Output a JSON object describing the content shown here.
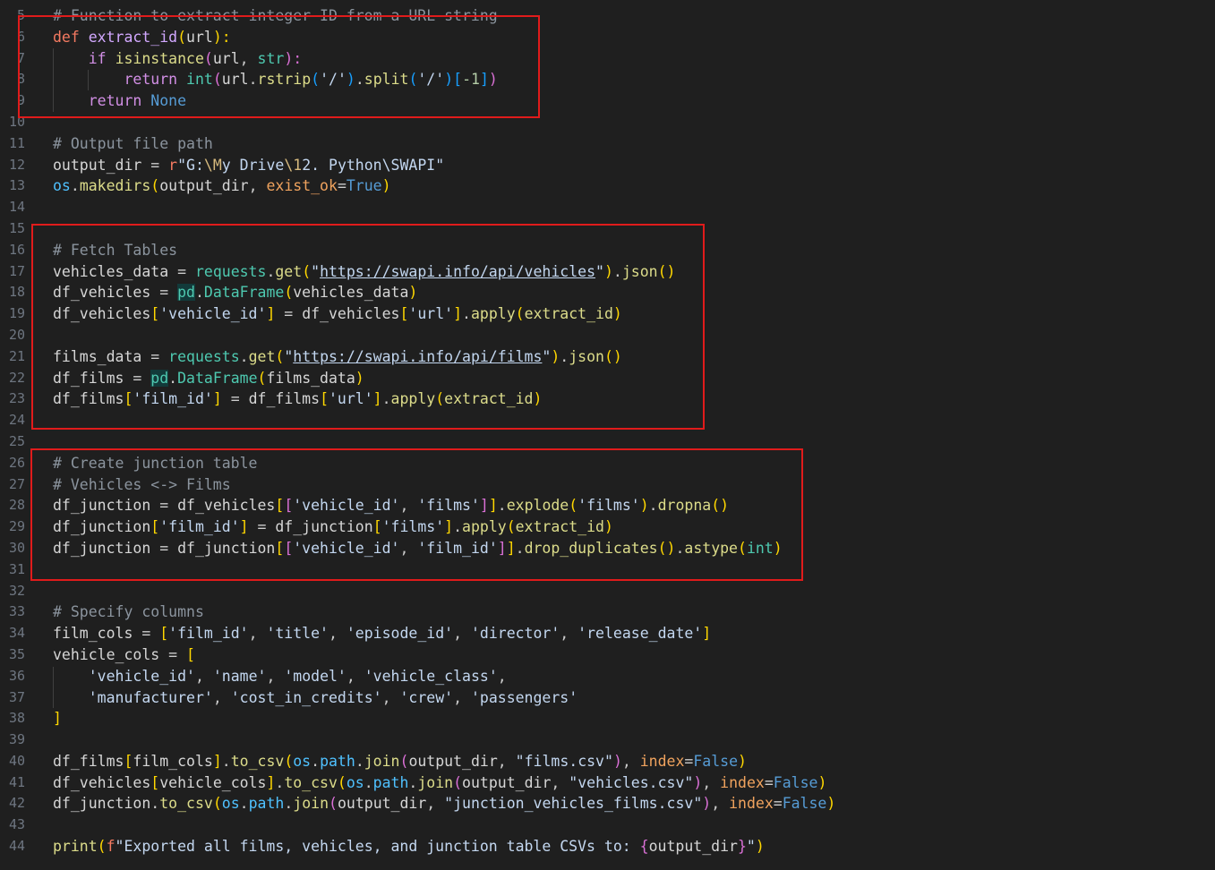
{
  "gutter": {
    "line_numbers": [
      "5",
      "6",
      "7",
      "8",
      "9",
      "10",
      "11",
      "12",
      "13",
      "14",
      "15",
      "16",
      "17",
      "18",
      "19",
      "20",
      "21",
      "22",
      "23",
      "24",
      "25",
      "26",
      "27",
      "28",
      "29",
      "30",
      "31",
      "32",
      "33",
      "34",
      "35",
      "36",
      "37",
      "38",
      "39",
      "40",
      "41",
      "42",
      "43",
      "44"
    ]
  },
  "code_lines": [
    [
      {
        "t": "# Function to extract integer ID from a URL string",
        "c": "cm"
      }
    ],
    [
      {
        "t": "def ",
        "c": "kw"
      },
      {
        "t": "extract_id",
        "c": "fn"
      },
      {
        "t": "(",
        "c": "p1"
      },
      {
        "t": "url",
        "c": "var"
      },
      {
        "t": "):",
        "c": "p1"
      }
    ],
    [
      {
        "t": "    ",
        "c": "op"
      },
      {
        "t": "if ",
        "c": "ctl"
      },
      {
        "t": "isinstance",
        "c": "fnB"
      },
      {
        "t": "(",
        "c": "p2"
      },
      {
        "t": "url",
        "c": "var"
      },
      {
        "t": ", ",
        "c": "op"
      },
      {
        "t": "str",
        "c": "builtin"
      },
      {
        "t": "):",
        "c": "p2"
      }
    ],
    [
      {
        "t": "        ",
        "c": "op"
      },
      {
        "t": "return ",
        "c": "ctl"
      },
      {
        "t": "int",
        "c": "builtin"
      },
      {
        "t": "(",
        "c": "p2"
      },
      {
        "t": "url",
        "c": "var"
      },
      {
        "t": ".",
        "c": "op"
      },
      {
        "t": "rstrip",
        "c": "fnB"
      },
      {
        "t": "(",
        "c": "p3"
      },
      {
        "t": "'/'",
        "c": "str"
      },
      {
        "t": ")",
        "c": "p3"
      },
      {
        "t": ".",
        "c": "op"
      },
      {
        "t": "split",
        "c": "fnB"
      },
      {
        "t": "(",
        "c": "p3"
      },
      {
        "t": "'/'",
        "c": "str"
      },
      {
        "t": ")",
        "c": "p3"
      },
      {
        "t": "[",
        "c": "p3"
      },
      {
        "t": "-1",
        "c": "num"
      },
      {
        "t": "]",
        "c": "p3"
      },
      {
        "t": ")",
        "c": "p2"
      }
    ],
    [
      {
        "t": "    ",
        "c": "op"
      },
      {
        "t": "return ",
        "c": "ctl"
      },
      {
        "t": "None",
        "c": "const"
      }
    ],
    [],
    [
      {
        "t": "# Output file path",
        "c": "cm"
      }
    ],
    [
      {
        "t": "output_dir",
        "c": "var"
      },
      {
        "t": " = ",
        "c": "op"
      },
      {
        "t": "r",
        "c": "kw"
      },
      {
        "t": "\"G:",
        "c": "str"
      },
      {
        "t": "\\M",
        "c": "esc"
      },
      {
        "t": "y Drive",
        "c": "str"
      },
      {
        "t": "\\1",
        "c": "esc"
      },
      {
        "t": "2. Python\\SWAPI\"",
        "c": "str"
      }
    ],
    [
      {
        "t": "os",
        "c": "mod"
      },
      {
        "t": ".",
        "c": "op"
      },
      {
        "t": "makedirs",
        "c": "fnB"
      },
      {
        "t": "(",
        "c": "p1"
      },
      {
        "t": "output_dir",
        "c": "var"
      },
      {
        "t": ", ",
        "c": "op"
      },
      {
        "t": "exist_ok",
        "c": "param"
      },
      {
        "t": "=",
        "c": "op"
      },
      {
        "t": "True",
        "c": "const"
      },
      {
        "t": ")",
        "c": "p1"
      }
    ],
    [],
    [],
    [
      {
        "t": "# Fetch Tables",
        "c": "cm"
      }
    ],
    [
      {
        "t": "vehicles_data",
        "c": "var"
      },
      {
        "t": " = ",
        "c": "op"
      },
      {
        "t": "requests",
        "c": "builtin"
      },
      {
        "t": ".",
        "c": "op"
      },
      {
        "t": "get",
        "c": "fnB"
      },
      {
        "t": "(",
        "c": "p1"
      },
      {
        "t": "\"",
        "c": "str"
      },
      {
        "t": "https://swapi.info/api/vehicles",
        "c": "url"
      },
      {
        "t": "\"",
        "c": "str"
      },
      {
        "t": ")",
        "c": "p1"
      },
      {
        "t": ".",
        "c": "op"
      },
      {
        "t": "json",
        "c": "fnB"
      },
      {
        "t": "()",
        "c": "p1"
      }
    ],
    [
      {
        "t": "df_vehicles",
        "c": "var"
      },
      {
        "t": " = ",
        "c": "op"
      },
      {
        "t": "pd",
        "c": "builtin hl"
      },
      {
        "t": ".",
        "c": "op"
      },
      {
        "t": "DataFrame",
        "c": "builtin"
      },
      {
        "t": "(",
        "c": "p1"
      },
      {
        "t": "vehicles_data",
        "c": "var"
      },
      {
        "t": ")",
        "c": "p1"
      }
    ],
    [
      {
        "t": "df_vehicles",
        "c": "var"
      },
      {
        "t": "[",
        "c": "p1"
      },
      {
        "t": "'vehicle_id'",
        "c": "str"
      },
      {
        "t": "]",
        "c": "p1"
      },
      {
        "t": " = ",
        "c": "op"
      },
      {
        "t": "df_vehicles",
        "c": "var"
      },
      {
        "t": "[",
        "c": "p1"
      },
      {
        "t": "'url'",
        "c": "str"
      },
      {
        "t": "]",
        "c": "p1"
      },
      {
        "t": ".",
        "c": "op"
      },
      {
        "t": "apply",
        "c": "fnB"
      },
      {
        "t": "(",
        "c": "p1"
      },
      {
        "t": "extract_id",
        "c": "fnB"
      },
      {
        "t": ")",
        "c": "p1"
      }
    ],
    [],
    [
      {
        "t": "films_data",
        "c": "var"
      },
      {
        "t": " = ",
        "c": "op"
      },
      {
        "t": "requests",
        "c": "builtin"
      },
      {
        "t": ".",
        "c": "op"
      },
      {
        "t": "get",
        "c": "fnB"
      },
      {
        "t": "(",
        "c": "p1"
      },
      {
        "t": "\"",
        "c": "str"
      },
      {
        "t": "https://swapi.info/api/films",
        "c": "url"
      },
      {
        "t": "\"",
        "c": "str"
      },
      {
        "t": ")",
        "c": "p1"
      },
      {
        "t": ".",
        "c": "op"
      },
      {
        "t": "json",
        "c": "fnB"
      },
      {
        "t": "()",
        "c": "p1"
      }
    ],
    [
      {
        "t": "df_films",
        "c": "var"
      },
      {
        "t": " = ",
        "c": "op"
      },
      {
        "t": "pd",
        "c": "builtin hl"
      },
      {
        "t": ".",
        "c": "op"
      },
      {
        "t": "DataFrame",
        "c": "builtin"
      },
      {
        "t": "(",
        "c": "p1"
      },
      {
        "t": "films_data",
        "c": "var"
      },
      {
        "t": ")",
        "c": "p1"
      }
    ],
    [
      {
        "t": "df_films",
        "c": "var"
      },
      {
        "t": "[",
        "c": "p1"
      },
      {
        "t": "'film_id'",
        "c": "str"
      },
      {
        "t": "]",
        "c": "p1"
      },
      {
        "t": " = ",
        "c": "op"
      },
      {
        "t": "df_films",
        "c": "var"
      },
      {
        "t": "[",
        "c": "p1"
      },
      {
        "t": "'url'",
        "c": "str"
      },
      {
        "t": "]",
        "c": "p1"
      },
      {
        "t": ".",
        "c": "op"
      },
      {
        "t": "apply",
        "c": "fnB"
      },
      {
        "t": "(",
        "c": "p1"
      },
      {
        "t": "extract_id",
        "c": "fnB"
      },
      {
        "t": ")",
        "c": "p1"
      }
    ],
    [],
    [],
    [
      {
        "t": "# Create junction table",
        "c": "cm"
      }
    ],
    [
      {
        "t": "# Vehicles <-> Films",
        "c": "cm"
      }
    ],
    [
      {
        "t": "df_junction",
        "c": "var"
      },
      {
        "t": " = ",
        "c": "op"
      },
      {
        "t": "df_vehicles",
        "c": "var"
      },
      {
        "t": "[",
        "c": "p1"
      },
      {
        "t": "[",
        "c": "p2"
      },
      {
        "t": "'vehicle_id'",
        "c": "str"
      },
      {
        "t": ", ",
        "c": "op"
      },
      {
        "t": "'films'",
        "c": "str"
      },
      {
        "t": "]",
        "c": "p2"
      },
      {
        "t": "]",
        "c": "p1"
      },
      {
        "t": ".",
        "c": "op"
      },
      {
        "t": "explode",
        "c": "fnB"
      },
      {
        "t": "(",
        "c": "p1"
      },
      {
        "t": "'films'",
        "c": "str"
      },
      {
        "t": ")",
        "c": "p1"
      },
      {
        "t": ".",
        "c": "op"
      },
      {
        "t": "dropna",
        "c": "fnB"
      },
      {
        "t": "()",
        "c": "p1"
      }
    ],
    [
      {
        "t": "df_junction",
        "c": "var"
      },
      {
        "t": "[",
        "c": "p1"
      },
      {
        "t": "'film_id'",
        "c": "str"
      },
      {
        "t": "]",
        "c": "p1"
      },
      {
        "t": " = ",
        "c": "op"
      },
      {
        "t": "df_junction",
        "c": "var"
      },
      {
        "t": "[",
        "c": "p1"
      },
      {
        "t": "'films'",
        "c": "str"
      },
      {
        "t": "]",
        "c": "p1"
      },
      {
        "t": ".",
        "c": "op"
      },
      {
        "t": "apply",
        "c": "fnB"
      },
      {
        "t": "(",
        "c": "p1"
      },
      {
        "t": "extract_id",
        "c": "fnB"
      },
      {
        "t": ")",
        "c": "p1"
      }
    ],
    [
      {
        "t": "df_junction",
        "c": "var"
      },
      {
        "t": " = ",
        "c": "op"
      },
      {
        "t": "df_junction",
        "c": "var"
      },
      {
        "t": "[",
        "c": "p1"
      },
      {
        "t": "[",
        "c": "p2"
      },
      {
        "t": "'vehicle_id'",
        "c": "str"
      },
      {
        "t": ", ",
        "c": "op"
      },
      {
        "t": "'film_id'",
        "c": "str"
      },
      {
        "t": "]",
        "c": "p2"
      },
      {
        "t": "]",
        "c": "p1"
      },
      {
        "t": ".",
        "c": "op"
      },
      {
        "t": "drop_duplicates",
        "c": "fnB"
      },
      {
        "t": "()",
        "c": "p1"
      },
      {
        "t": ".",
        "c": "op"
      },
      {
        "t": "astype",
        "c": "fnB"
      },
      {
        "t": "(",
        "c": "p1"
      },
      {
        "t": "int",
        "c": "builtin"
      },
      {
        "t": ")",
        "c": "p1"
      }
    ],
    [],
    [],
    [
      {
        "t": "# Specify columns",
        "c": "cm"
      }
    ],
    [
      {
        "t": "film_cols",
        "c": "var"
      },
      {
        "t": " = ",
        "c": "op"
      },
      {
        "t": "[",
        "c": "p1"
      },
      {
        "t": "'film_id'",
        "c": "str"
      },
      {
        "t": ", ",
        "c": "op"
      },
      {
        "t": "'title'",
        "c": "str"
      },
      {
        "t": ", ",
        "c": "op"
      },
      {
        "t": "'episode_id'",
        "c": "str"
      },
      {
        "t": ", ",
        "c": "op"
      },
      {
        "t": "'director'",
        "c": "str"
      },
      {
        "t": ", ",
        "c": "op"
      },
      {
        "t": "'release_date'",
        "c": "str"
      },
      {
        "t": "]",
        "c": "p1"
      }
    ],
    [
      {
        "t": "vehicle_cols",
        "c": "var"
      },
      {
        "t": " = ",
        "c": "op"
      },
      {
        "t": "[",
        "c": "p1"
      }
    ],
    [
      {
        "t": "    ",
        "c": "op"
      },
      {
        "t": "'vehicle_id'",
        "c": "str"
      },
      {
        "t": ", ",
        "c": "op"
      },
      {
        "t": "'name'",
        "c": "str"
      },
      {
        "t": ", ",
        "c": "op"
      },
      {
        "t": "'model'",
        "c": "str"
      },
      {
        "t": ", ",
        "c": "op"
      },
      {
        "t": "'vehicle_class'",
        "c": "str"
      },
      {
        "t": ",",
        "c": "op"
      }
    ],
    [
      {
        "t": "    ",
        "c": "op"
      },
      {
        "t": "'manufacturer'",
        "c": "str"
      },
      {
        "t": ", ",
        "c": "op"
      },
      {
        "t": "'cost_in_credits'",
        "c": "str"
      },
      {
        "t": ", ",
        "c": "op"
      },
      {
        "t": "'crew'",
        "c": "str"
      },
      {
        "t": ", ",
        "c": "op"
      },
      {
        "t": "'passengers'",
        "c": "str"
      }
    ],
    [
      {
        "t": "]",
        "c": "p1"
      }
    ],
    [],
    [
      {
        "t": "df_films",
        "c": "var"
      },
      {
        "t": "[",
        "c": "p1"
      },
      {
        "t": "film_cols",
        "c": "var"
      },
      {
        "t": "]",
        "c": "p1"
      },
      {
        "t": ".",
        "c": "op"
      },
      {
        "t": "to_csv",
        "c": "fnB"
      },
      {
        "t": "(",
        "c": "p1"
      },
      {
        "t": "os",
        "c": "mod"
      },
      {
        "t": ".",
        "c": "op"
      },
      {
        "t": "path",
        "c": "mod"
      },
      {
        "t": ".",
        "c": "op"
      },
      {
        "t": "join",
        "c": "fnB"
      },
      {
        "t": "(",
        "c": "p2"
      },
      {
        "t": "output_dir",
        "c": "var"
      },
      {
        "t": ", ",
        "c": "op"
      },
      {
        "t": "\"films.csv\"",
        "c": "str"
      },
      {
        "t": ")",
        "c": "p2"
      },
      {
        "t": ", ",
        "c": "op"
      },
      {
        "t": "index",
        "c": "param"
      },
      {
        "t": "=",
        "c": "op"
      },
      {
        "t": "False",
        "c": "const"
      },
      {
        "t": ")",
        "c": "p1"
      }
    ],
    [
      {
        "t": "df_vehicles",
        "c": "var"
      },
      {
        "t": "[",
        "c": "p1"
      },
      {
        "t": "vehicle_cols",
        "c": "var"
      },
      {
        "t": "]",
        "c": "p1"
      },
      {
        "t": ".",
        "c": "op"
      },
      {
        "t": "to_csv",
        "c": "fnB"
      },
      {
        "t": "(",
        "c": "p1"
      },
      {
        "t": "os",
        "c": "mod"
      },
      {
        "t": ".",
        "c": "op"
      },
      {
        "t": "path",
        "c": "mod"
      },
      {
        "t": ".",
        "c": "op"
      },
      {
        "t": "join",
        "c": "fnB"
      },
      {
        "t": "(",
        "c": "p2"
      },
      {
        "t": "output_dir",
        "c": "var"
      },
      {
        "t": ", ",
        "c": "op"
      },
      {
        "t": "\"vehicles.csv\"",
        "c": "str"
      },
      {
        "t": ")",
        "c": "p2"
      },
      {
        "t": ", ",
        "c": "op"
      },
      {
        "t": "index",
        "c": "param"
      },
      {
        "t": "=",
        "c": "op"
      },
      {
        "t": "False",
        "c": "const"
      },
      {
        "t": ")",
        "c": "p1"
      }
    ],
    [
      {
        "t": "df_junction",
        "c": "var"
      },
      {
        "t": ".",
        "c": "op"
      },
      {
        "t": "to_csv",
        "c": "fnB"
      },
      {
        "t": "(",
        "c": "p1"
      },
      {
        "t": "os",
        "c": "mod"
      },
      {
        "t": ".",
        "c": "op"
      },
      {
        "t": "path",
        "c": "mod"
      },
      {
        "t": ".",
        "c": "op"
      },
      {
        "t": "join",
        "c": "fnB"
      },
      {
        "t": "(",
        "c": "p2"
      },
      {
        "t": "output_dir",
        "c": "var"
      },
      {
        "t": ", ",
        "c": "op"
      },
      {
        "t": "\"junction_vehicles_films.csv\"",
        "c": "str"
      },
      {
        "t": ")",
        "c": "p2"
      },
      {
        "t": ", ",
        "c": "op"
      },
      {
        "t": "index",
        "c": "param"
      },
      {
        "t": "=",
        "c": "op"
      },
      {
        "t": "False",
        "c": "const"
      },
      {
        "t": ")",
        "c": "p1"
      }
    ],
    [],
    [
      {
        "t": "print",
        "c": "fnB"
      },
      {
        "t": "(",
        "c": "p1"
      },
      {
        "t": "f",
        "c": "kw"
      },
      {
        "t": "\"Exported all films, vehicles, and junction table CSVs to: ",
        "c": "str"
      },
      {
        "t": "{",
        "c": "p2"
      },
      {
        "t": "output_dir",
        "c": "var"
      },
      {
        "t": "}",
        "c": "p2"
      },
      {
        "t": "\"",
        "c": "str"
      },
      {
        "t": ")",
        "c": "p1"
      }
    ]
  ],
  "colors": {
    "background": "#1f1f1f",
    "highlight_box": "#e01b1b",
    "line_number": "#6e7681"
  }
}
